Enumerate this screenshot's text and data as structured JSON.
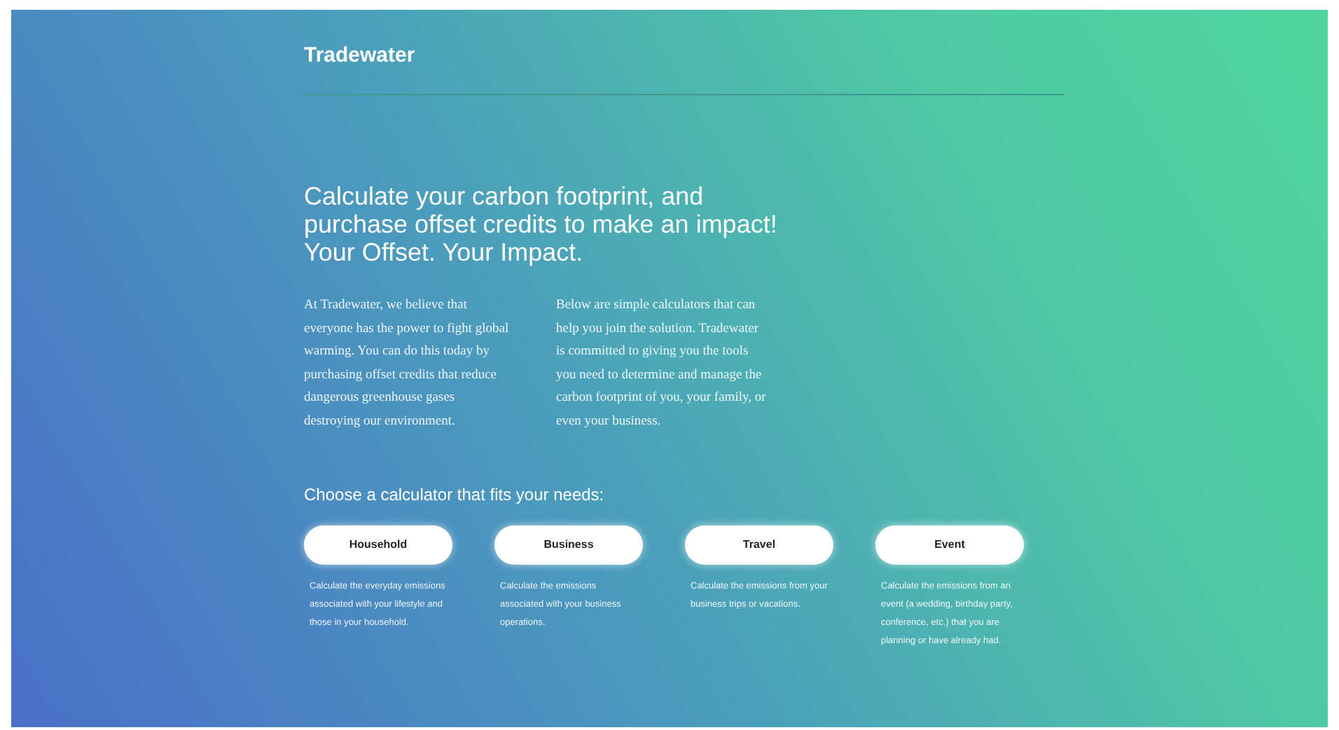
{
  "header": {
    "logo": "Tradewater"
  },
  "hero": {
    "heading_lines": [
      "Calculate your carbon footprint, and",
      "purchase offset credits to make an impact!",
      "Your Offset. Your Impact."
    ]
  },
  "intro": {
    "paragraphs": [
      "At Tradewater, we believe that everyone has the power to fight global warming. You can do this today by purchasing offset credits that reduce dangerous greenhouse gases destroying our environment.",
      "Below are simple calculators that can help you join the solution. Tradewater is committed to giving you the tools you need to determine and manage the carbon footprint of you, your family, or even your business."
    ]
  },
  "calculators": {
    "prompt": "Choose a calculator that fits your needs:",
    "items": [
      {
        "label": "Household",
        "description": "Calculate the everyday emissions associated with your lifestyle and those in your household."
      },
      {
        "label": "Business",
        "description": "Calculate the emissions associated with your business operations."
      },
      {
        "label": "Travel",
        "description": "Calculate the emissions from your business trips or vacations."
      },
      {
        "label": "Event",
        "description": "Calculate the emissions from an event (a wedding, birthday party, conference, etc.) that you are planning or have already had."
      }
    ]
  }
}
